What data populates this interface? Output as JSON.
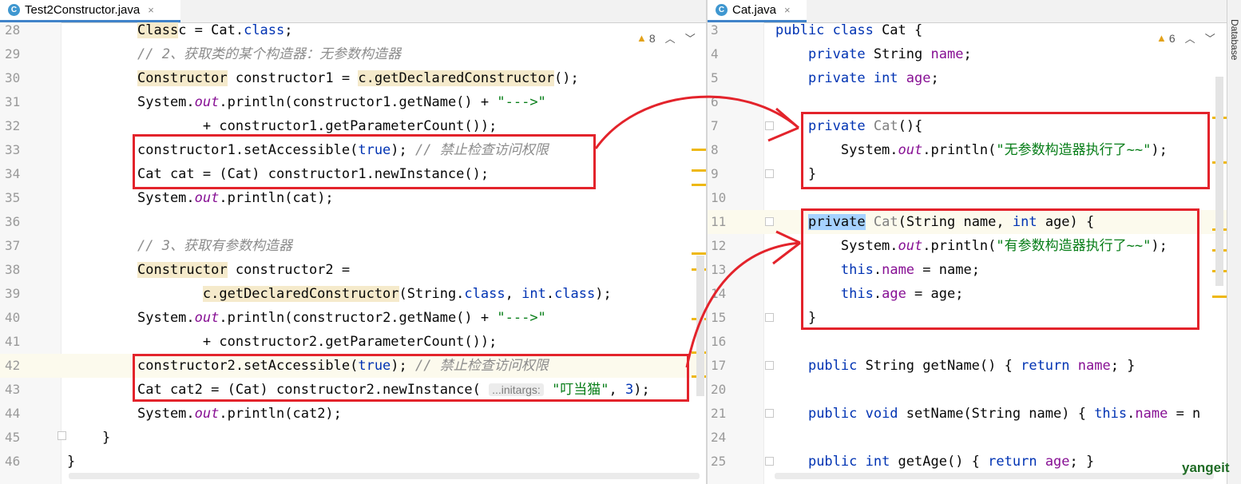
{
  "left_tab": {
    "label": "Test2Constructor.java",
    "icon": "java-class-icon",
    "close": "×"
  },
  "right_tab": {
    "label": "Cat.java",
    "icon": "java-class-icon",
    "close": "×"
  },
  "left_inspect": {
    "count": "8"
  },
  "right_inspect": {
    "count": "6"
  },
  "tool_strip": {
    "database_label": "Database"
  },
  "watermark": "yangeit",
  "colors": {
    "annotation_red": "#e3232b",
    "keyword": "#0033b3",
    "string": "#067d17",
    "comment": "#8c8c8c"
  },
  "left_code": [
    {
      "n": "28",
      "parts": [
        [
          "warn-type",
          "Class"
        ],
        [
          "",
          "c = Cat."
        ],
        [
          "kw",
          "class"
        ],
        [
          "",
          ";"
        ]
      ]
    },
    {
      "n": "29",
      "parts": [
        [
          "cm",
          "// 2、获取类的某个构造器：无参数构造器"
        ]
      ]
    },
    {
      "n": "30",
      "parts": [
        [
          "warn-type",
          "Constructor"
        ],
        [
          "",
          " constructor1 = "
        ],
        [
          "warn-type",
          "c.getDeclaredConstructor"
        ],
        [
          "",
          "();"
        ]
      ]
    },
    {
      "n": "31",
      "parts": [
        [
          "",
          "System."
        ],
        [
          "ital",
          "out"
        ],
        [
          "",
          ".println(constructor1.getName() + "
        ],
        [
          "str",
          "\"--->\""
        ]
      ]
    },
    {
      "n": "32",
      "parts": [
        [
          "",
          "        + constructor1.getParameterCount());"
        ]
      ]
    },
    {
      "n": "33",
      "parts": [
        [
          "",
          "constructor1.setAccessible("
        ],
        [
          "kw",
          "true"
        ],
        [
          "",
          "); "
        ],
        [
          "cm",
          "// 禁止检查访问权限"
        ]
      ]
    },
    {
      "n": "34",
      "parts": [
        [
          "",
          "Cat cat = (Cat) constructor1.newInstance();"
        ]
      ]
    },
    {
      "n": "35",
      "parts": [
        [
          "",
          "System."
        ],
        [
          "ital",
          "out"
        ],
        [
          "",
          ".println(cat);"
        ]
      ]
    },
    {
      "n": "36",
      "parts": []
    },
    {
      "n": "37",
      "parts": [
        [
          "cm",
          "// 3、获取有参数构造器"
        ]
      ]
    },
    {
      "n": "38",
      "parts": [
        [
          "warn-type",
          "Constructor"
        ],
        [
          "",
          " constructor2 ="
        ]
      ]
    },
    {
      "n": "39",
      "parts": [
        [
          "",
          "        "
        ],
        [
          "warn-type",
          "c.getDeclaredConstructor"
        ],
        [
          "",
          "(String."
        ],
        [
          "kw",
          "class"
        ],
        [
          "",
          ", "
        ],
        [
          "kw",
          "int"
        ],
        [
          "",
          "."
        ],
        [
          "kw",
          "class"
        ],
        [
          "",
          "); "
        ]
      ]
    },
    {
      "n": "40",
      "parts": [
        [
          "",
          "System."
        ],
        [
          "ital",
          "out"
        ],
        [
          "",
          ".println(constructor2.getName() + "
        ],
        [
          "str",
          "\"--->\""
        ]
      ]
    },
    {
      "n": "41",
      "parts": [
        [
          "",
          "        + constructor2.getParameterCount());"
        ]
      ]
    },
    {
      "n": "42",
      "parts": [
        [
          "",
          "constructor2.setAccessible("
        ],
        [
          "kw",
          "true"
        ],
        [
          "",
          "); "
        ],
        [
          "cm",
          "// 禁止检查访问权限"
        ]
      ]
    },
    {
      "n": "43",
      "parts": [
        [
          "",
          "Cat cat2 = (Cat) constructor2.newInstance( "
        ],
        [
          "hint",
          "...initargs:"
        ],
        [
          "",
          " "
        ],
        [
          "str",
          "\"叮当猫\""
        ],
        [
          "",
          ", "
        ],
        [
          "kw",
          "3"
        ],
        [
          "",
          ");"
        ]
      ]
    },
    {
      "n": "44",
      "parts": [
        [
          "",
          "System."
        ],
        [
          "ital",
          "out"
        ],
        [
          "",
          ".println(cat2);"
        ]
      ]
    },
    {
      "n": "45",
      "parts": [
        [
          "",
          "}"
        ]
      ]
    },
    {
      "n": "46",
      "parts": [
        [
          "",
          "}"
        ]
      ]
    }
  ],
  "right_code": [
    {
      "n": "3",
      "parts": [
        [
          "kw",
          "public class"
        ],
        [
          "",
          " Cat {"
        ]
      ]
    },
    {
      "n": "4",
      "parts": [
        [
          "",
          "    "
        ],
        [
          "kw",
          "private"
        ],
        [
          "",
          " String "
        ],
        [
          "fld",
          "name"
        ],
        [
          "",
          ";"
        ]
      ]
    },
    {
      "n": "5",
      "parts": [
        [
          "",
          "    "
        ],
        [
          "kw",
          "private int"
        ],
        [
          "",
          " "
        ],
        [
          "fld",
          "age"
        ],
        [
          "",
          ";"
        ]
      ]
    },
    {
      "n": "6",
      "parts": []
    },
    {
      "n": "7",
      "parts": [
        [
          "",
          "    "
        ],
        [
          "kw",
          "private"
        ],
        [
          "",
          " "
        ],
        [
          "decl",
          "Cat"
        ],
        [
          "",
          "(){"
        ]
      ]
    },
    {
      "n": "8",
      "parts": [
        [
          "",
          "        System."
        ],
        [
          "ital",
          "out"
        ],
        [
          "",
          ".println("
        ],
        [
          "str",
          "\"无参数构造器执行了~~\""
        ],
        [
          "",
          ");"
        ]
      ]
    },
    {
      "n": "9",
      "parts": [
        [
          "",
          "    }"
        ]
      ]
    },
    {
      "n": "10",
      "parts": []
    },
    {
      "n": "11",
      "parts": [
        [
          "",
          "    "
        ],
        [
          "sel",
          "private"
        ],
        [
          "",
          " "
        ],
        [
          "decl",
          "Cat"
        ],
        [
          "",
          "(String name, "
        ],
        [
          "kw",
          "int"
        ],
        [
          "",
          " age) {"
        ]
      ]
    },
    {
      "n": "12",
      "parts": [
        [
          "",
          "        System."
        ],
        [
          "ital",
          "out"
        ],
        [
          "",
          ".println("
        ],
        [
          "str",
          "\"有参数构造器执行了~~\""
        ],
        [
          "",
          ");"
        ]
      ]
    },
    {
      "n": "13",
      "parts": [
        [
          "",
          "        "
        ],
        [
          "kw",
          "this"
        ],
        [
          "",
          "."
        ],
        [
          "fld",
          "name"
        ],
        [
          "",
          " = name;"
        ]
      ]
    },
    {
      "n": "14",
      "parts": [
        [
          "",
          "        "
        ],
        [
          "kw",
          "this"
        ],
        [
          "",
          "."
        ],
        [
          "fld",
          "age"
        ],
        [
          "",
          " = age;"
        ]
      ]
    },
    {
      "n": "15",
      "parts": [
        [
          "",
          "    }"
        ]
      ]
    },
    {
      "n": "16",
      "parts": []
    },
    {
      "n": "17",
      "parts": [
        [
          "",
          "    "
        ],
        [
          "kw",
          "public"
        ],
        [
          "",
          " String "
        ],
        [
          "",
          "getName() { "
        ],
        [
          "kw",
          "return"
        ],
        [
          "",
          " "
        ],
        [
          "fld",
          "name"
        ],
        [
          "",
          "; }"
        ]
      ]
    },
    {
      "n": "20",
      "parts": []
    },
    {
      "n": "21",
      "parts": [
        [
          "",
          "    "
        ],
        [
          "kw",
          "public void"
        ],
        [
          "",
          " setName(String name) { "
        ],
        [
          "kw",
          "this"
        ],
        [
          "",
          "."
        ],
        [
          "fld",
          "name"
        ],
        [
          "",
          " = n"
        ]
      ]
    },
    {
      "n": "24",
      "parts": []
    },
    {
      "n": "25",
      "parts": [
        [
          "",
          "    "
        ],
        [
          "kw",
          "public int"
        ],
        [
          "",
          " getAge() { "
        ],
        [
          "kw",
          "return"
        ],
        [
          "",
          " "
        ],
        [
          "fld",
          "age"
        ],
        [
          "",
          "; }"
        ]
      ]
    }
  ]
}
